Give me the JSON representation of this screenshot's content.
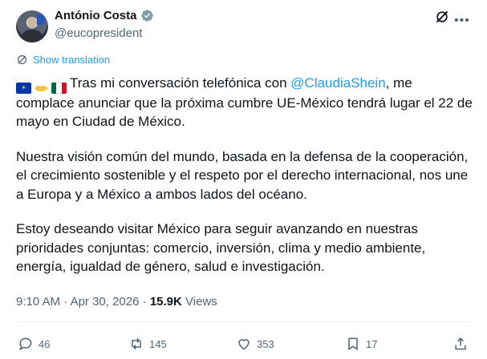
{
  "author": {
    "name": "António Costa",
    "handle": "@eucopresident"
  },
  "translate": {
    "label": "Show translation"
  },
  "tweet": {
    "p1_prefix": "Tras mi conversación telefónica con ",
    "mention": "@ClaudiaShein",
    "p1_suffix": ", me complace anunciar que la próxima cumbre UE-México tendrá lugar el 22 de mayo en Ciudad de México.",
    "p2": "Nuestra visión común del mundo, basada en la defensa de la cooperación, el crecimiento sostenible y el respeto por el derecho internacional, nos une a Europa y a México a ambos lados del océano.",
    "p3": "Estoy deseando visitar México para seguir avanzando en nuestras prioridades conjuntas: comercio, inversión, clima y medio ambiente, energía, igualdad de género, salud e investigación."
  },
  "meta": {
    "time": "9:10 AM",
    "separator": "·",
    "date": "Apr 30, 2026",
    "views_count": "15.9K",
    "views_label": "Views"
  },
  "actions": {
    "replies": "46",
    "reposts": "145",
    "likes": "353",
    "bookmarks": "17"
  },
  "colors": {
    "accent": "#1d9bf0",
    "text": "#0f1419",
    "muted": "#536471"
  }
}
